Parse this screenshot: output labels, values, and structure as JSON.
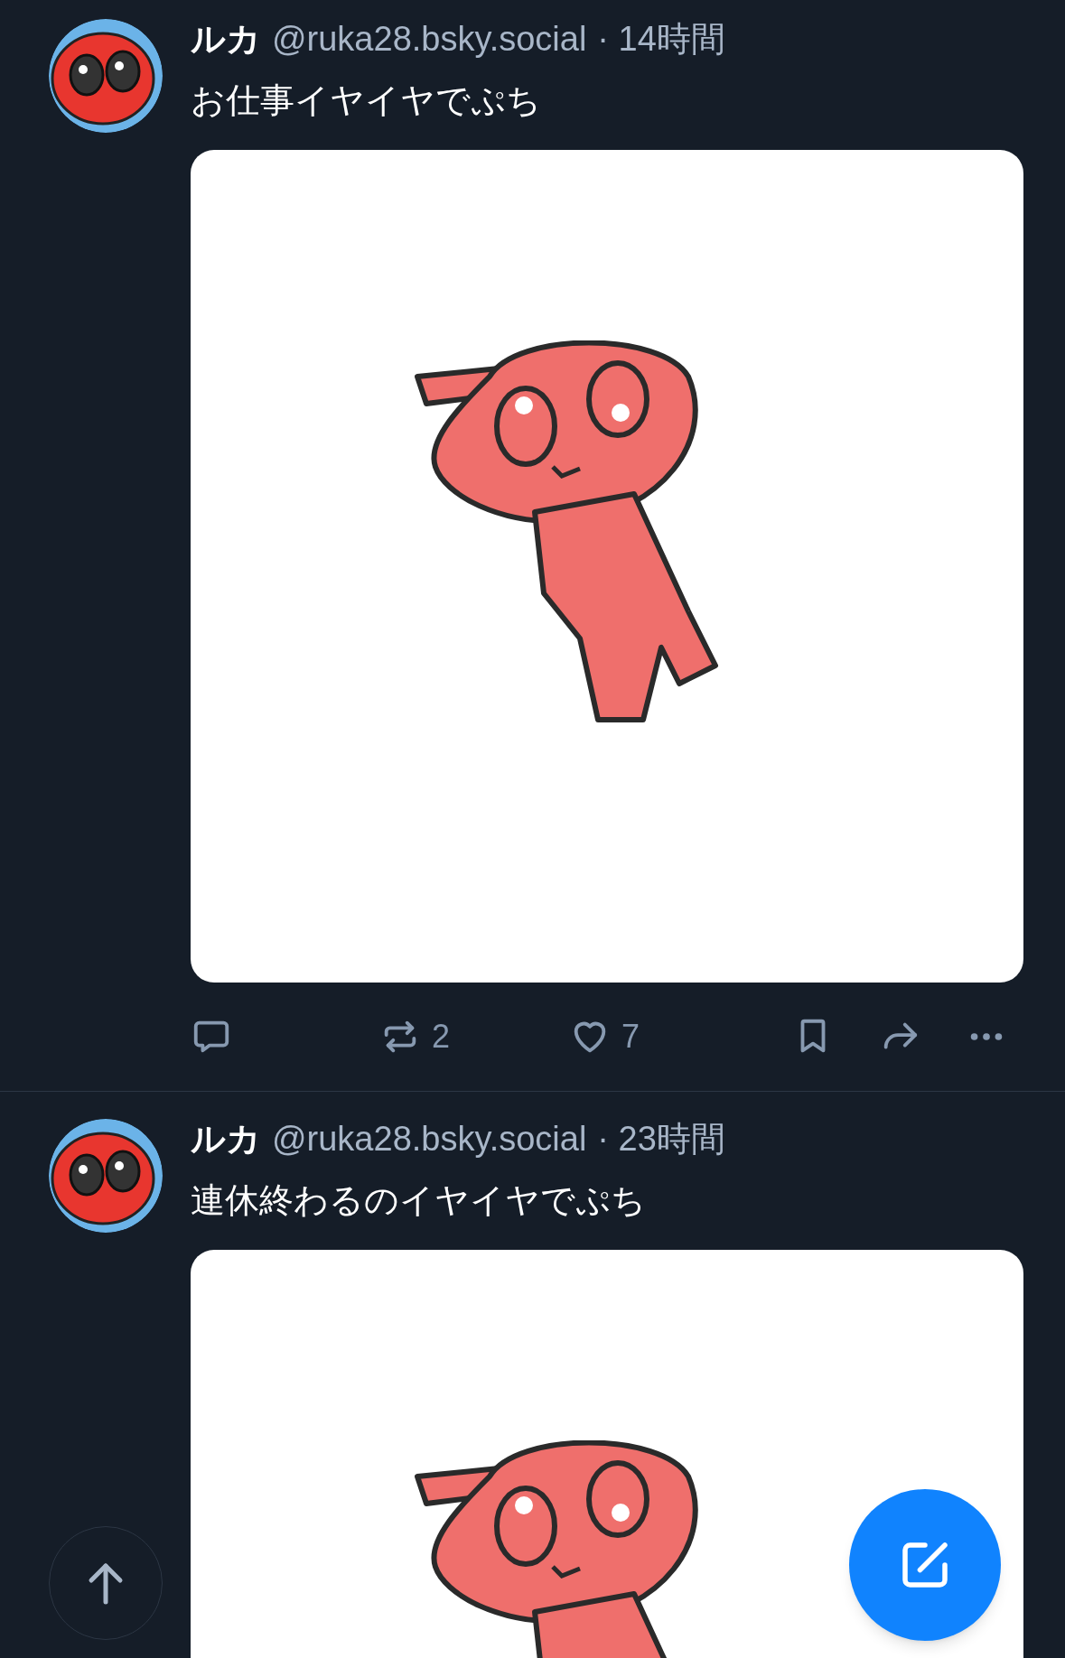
{
  "posts": [
    {
      "display_name": "ルカ",
      "handle": "@ruka28.bsky.social",
      "time": "· 14時間",
      "text": "お仕事イヤイヤでぷち",
      "actions": {
        "reposts": "2",
        "likes": "7"
      }
    },
    {
      "display_name": "ルカ",
      "handle": "@ruka28.bsky.social",
      "time": "· 23時間",
      "text": "連休終わるのイヤイヤでぷち"
    }
  ],
  "floating_buttons": [
    {
      "kind": "scroll_top"
    },
    {
      "kind": "compose"
    }
  ]
}
